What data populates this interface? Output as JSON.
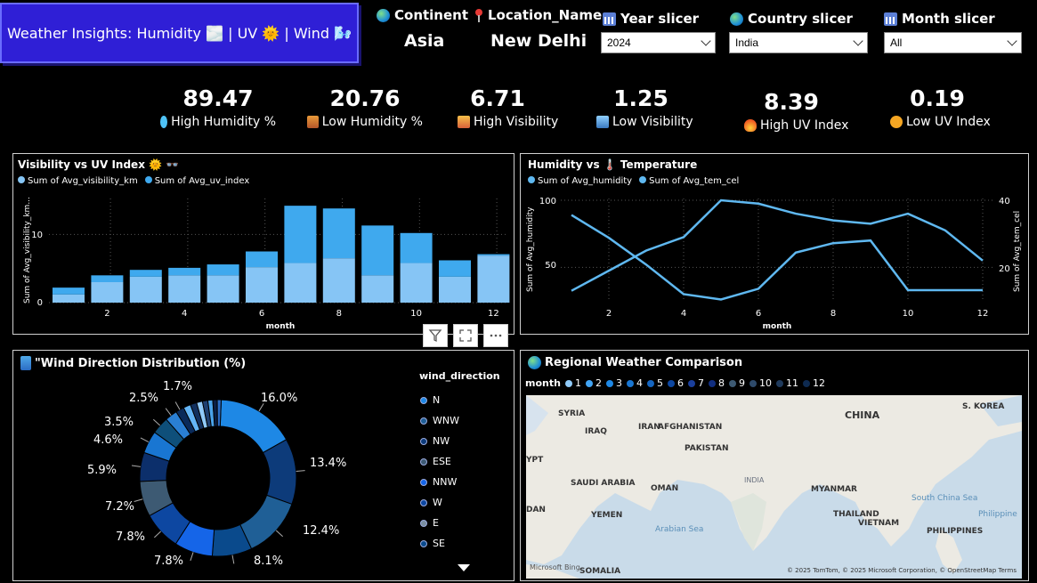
{
  "title": "Weather Insights: Humidity 🌫️ | UV 🌞 | Wind 🌬️",
  "header": {
    "continent_label": "Continent",
    "continent_value": "Asia",
    "location_label": "Location_Name",
    "location_value": "New Delhi",
    "year_label": "Year slicer",
    "year_value": "2024",
    "country_label": "Country slicer",
    "country_value": "India",
    "month_label": "Month slicer",
    "month_value": "All"
  },
  "kpis": [
    {
      "value": "89.47",
      "label": "High Humidity %",
      "icon": "droplets-icon",
      "color": "#4fc3f7"
    },
    {
      "value": "20.76",
      "label": "Low Humidity %",
      "icon": "desert-icon",
      "color": "#e57c3a"
    },
    {
      "value": "6.71",
      "label": "High Visibility",
      "icon": "sunrise-icon",
      "color": "#f0a030"
    },
    {
      "value": "1.25",
      "label": "Low Visibility",
      "icon": "fog-icon",
      "color": "#5aa0d8"
    },
    {
      "value": "8.39",
      "label": "High UV Index",
      "icon": "fire-icon",
      "color": "#f05a22"
    },
    {
      "value": "0.19",
      "label": "Low UV Index",
      "icon": "sun-icon",
      "color": "#f5a623"
    }
  ],
  "visibility_chart": {
    "title": "Visibility vs UV Index 🌞 👓",
    "legend": [
      "Sum of Avg_visibility_km",
      "Sum of Avg_uv_index"
    ],
    "ylabel": "Sum of Avg_visibility_km...",
    "xlabel": "month",
    "yticks": [
      "0",
      "10"
    ],
    "xticks": [
      "2",
      "4",
      "6",
      "8",
      "10",
      "12"
    ]
  },
  "humidity_chart": {
    "title": "Humidity vs 🌡️ Temperature",
    "legend": [
      "Sum of Avg_humidity",
      "Sum of Avg_tem_cel"
    ],
    "ylabel_left": "Sum of Avg_humidity",
    "ylabel_right": "Sum of Avg_tem_cel",
    "xlabel": "month",
    "yticks_left": [
      "50",
      "100"
    ],
    "yticks_right": [
      "20",
      "40"
    ],
    "xticks": [
      "2",
      "4",
      "6",
      "8",
      "10",
      "12"
    ]
  },
  "wind_chart": {
    "title": "\"Wind Direction Distribution (%)",
    "legend_title": "wind_direction",
    "legend": [
      "N",
      "WNW",
      "NW",
      "ESE",
      "NNW",
      "W",
      "E",
      "SE"
    ],
    "labels": [
      "16.0%",
      "13.4%",
      "12.4%",
      "8.1%",
      "7.8%",
      "7.8%",
      "7.2%",
      "5.9%",
      "4.6%",
      "3.5%",
      "2.5%",
      "1.7%"
    ]
  },
  "map_panel": {
    "title": "Regional Weather Comparison",
    "legend_title": "month",
    "legend": [
      "1",
      "2",
      "3",
      "4",
      "5",
      "6",
      "7",
      "8",
      "9",
      "10",
      "11",
      "12"
    ],
    "places": [
      "SYRIA",
      "IRAQ",
      "IRAN",
      "AFGHANISTAN",
      "PAKISTAN",
      "CHINA",
      "S. KOREA",
      "YPT",
      "SAUDI ARABIA",
      "OMAN",
      "INDIA",
      "MYANMAR",
      "South China Sea",
      "DAN",
      "YEMEN",
      "THAILAND",
      "VIETNAM",
      "Philippine",
      "PHILIPPINES",
      "Arabian Sea",
      "SOMALIA"
    ],
    "attribution": "© 2025 TomTom, © 2025 Microsoft Corporation, © OpenStreetMap  Terms",
    "bing": "Microsoft Bing"
  },
  "chart_data": [
    {
      "type": "bar",
      "title": "Visibility vs UV Index 🌞 👓",
      "xlabel": "month",
      "ylabel": "Sum of Avg_visibility_km...",
      "x": [
        1,
        2,
        3,
        4,
        5,
        6,
        7,
        8,
        9,
        10,
        11,
        12
      ],
      "ylim": [
        0,
        15
      ],
      "series": [
        {
          "name": "Sum of Avg_visibility_km",
          "values": [
            1.2,
            3.0,
            3.8,
            4.0,
            4.0,
            5.2,
            5.8,
            6.5,
            4.0,
            5.8,
            3.8,
            6.9
          ],
          "color": "#86c5f5"
        },
        {
          "name": "Sum of Avg_uv_index",
          "values": [
            1.0,
            1.0,
            1.0,
            1.1,
            1.6,
            2.3,
            8.4,
            7.3,
            7.3,
            4.4,
            2.4,
            0.2
          ],
          "color": "#3fa9ee"
        }
      ]
    },
    {
      "type": "line",
      "title": "Humidity vs 🌡️ Temperature",
      "xlabel": "month",
      "x": [
        1,
        2,
        3,
        4,
        5,
        6,
        7,
        8,
        9,
        10,
        11,
        12
      ],
      "series": [
        {
          "name": "Sum of Avg_humidity",
          "axis": "left",
          "ylim": [
            25,
            100
          ],
          "values": [
            89,
            72,
            52,
            30,
            26,
            34,
            61,
            68,
            70,
            33,
            33,
            33
          ],
          "color": "#5fb8f0"
        },
        {
          "name": "Sum of Avg_tem_cel",
          "axis": "right",
          "ylim": [
            10,
            40
          ],
          "values": [
            13,
            19,
            25,
            29,
            40,
            39,
            36,
            34,
            33,
            36,
            31,
            22
          ],
          "color": "#5fb8f0"
        }
      ]
    },
    {
      "type": "pie",
      "title": "\"Wind Direction Distribution (%)",
      "values": [
        16.0,
        13.4,
        12.4,
        8.1,
        7.8,
        7.8,
        7.2,
        5.9,
        4.6,
        3.5,
        2.5,
        1.7,
        1.5,
        1.3,
        1.2,
        1.1,
        1.0,
        0.9,
        0.8
      ],
      "colors": [
        "#1e88e5",
        "#0d3b7a",
        "#1f5f96",
        "#0a4a8c",
        "#1565e8",
        "#0d47a1",
        "#3d5a73",
        "#0c2f6b",
        "#1976d2",
        "#0e4f7a",
        "#2a7fd4",
        "#0a2a5a",
        "#64b5f6",
        "#12305e",
        "#90caf9",
        "#1e3f70",
        "#4aa3ea",
        "#0b1f45",
        "#2b6cc4"
      ]
    }
  ]
}
